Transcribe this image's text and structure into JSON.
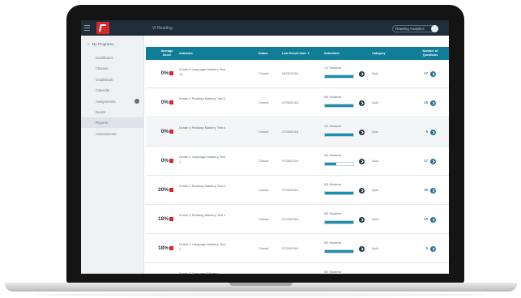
{
  "topbar": {
    "app_title": "VI Reading",
    "user_label": "Reading Analytics",
    "brand_color": "#d8282a"
  },
  "sidebar": {
    "head_chevron": "<",
    "head_label": "My Programs",
    "items": [
      {
        "label": "Dashboard"
      },
      {
        "label": "Classes"
      },
      {
        "label": "Gradebook"
      },
      {
        "label": "Calendar"
      },
      {
        "label": "Assignments"
      },
      {
        "label": "Books"
      },
      {
        "label": "Reports"
      },
      {
        "label": "Assessments"
      }
    ],
    "active_index": 6
  },
  "table": {
    "header_color": "#117e98",
    "headers": {
      "score": "Average Score",
      "activities": "Activities",
      "status": "Status",
      "due_date": "Last Result Date ▼",
      "submitted": "Submitted",
      "category": "Category",
      "questions": "Number of Questions"
    },
    "rows": [
      {
        "score": "0%",
        "activity": "Grade 4 Language Mastery Test 12",
        "status": "Closed",
        "date": "08/02/2016",
        "students": "1/1 Students",
        "progress": 1.0,
        "category": "Quiz",
        "questions": "17"
      },
      {
        "score": "0%",
        "activity": "Grade 4 Reading Mastery Test 1",
        "status": "Closed",
        "date": "07/30/2016",
        "students": "5/5 Students",
        "progress": 1.0,
        "category": "Quiz",
        "questions": "18"
      },
      {
        "score": "0%",
        "activity": "Grade 4 Reading Mastery Test 4",
        "status": "Closed",
        "date": "07/26/2016",
        "students": "1/1 Students",
        "progress": 1.0,
        "category": "Quiz",
        "questions": "5"
      },
      {
        "score": "0%",
        "activity": "Grade 4 Language Mastery Test 1",
        "status": "Closed",
        "date": "07/26/2016",
        "students": "2/5 Students",
        "progress": 0.4,
        "category": "Quiz",
        "questions": "17"
      },
      {
        "score": "20%",
        "activity": "Grade 2 Reading Mastery Test 3",
        "status": "Closed",
        "date": "07/20/2016",
        "students": "5/5 Students",
        "progress": 1.0,
        "category": "Quiz",
        "questions": "29"
      },
      {
        "score": "18%",
        "activity": "Grade 4 Reading Mastery Test 1",
        "status": "Closed",
        "date": "07/20/2016",
        "students": "5/5 Students",
        "progress": 1.0,
        "category": "Quiz",
        "questions": "18"
      },
      {
        "score": "18%",
        "activity": "Grade 2 Language Mastery Test 2",
        "status": "Closed",
        "date": "07/20/2016",
        "students": "5/5 Students",
        "progress": 1.0,
        "category": "Quiz",
        "questions": "5"
      },
      {
        "score": "",
        "activity": "Grade 2 Language Mastery",
        "status": "",
        "date": "",
        "students": "5/5 Students",
        "progress": 1.0,
        "category": "",
        "questions": ""
      }
    ]
  }
}
